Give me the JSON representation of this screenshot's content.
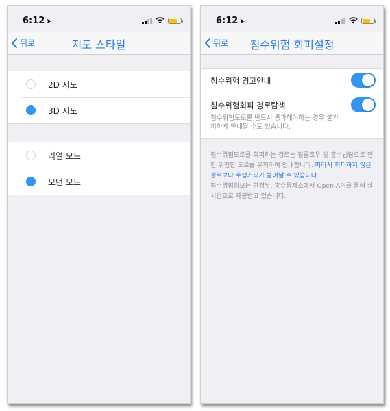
{
  "left": {
    "status": {
      "time": "6:12"
    },
    "nav": {
      "back_label": "뒤로",
      "title": "지도 스타일"
    },
    "groups": [
      {
        "items": [
          {
            "label": "2D 지도",
            "selected": false
          },
          {
            "label": "3D 지도",
            "selected": true
          }
        ]
      },
      {
        "items": [
          {
            "label": "리얼 모드",
            "selected": false
          },
          {
            "label": "모던 모드",
            "selected": true
          }
        ]
      }
    ]
  },
  "right": {
    "status": {
      "time": "6:12"
    },
    "nav": {
      "back_label": "뒤로",
      "title": "침수위험 회피설정"
    },
    "settings": [
      {
        "title": "침수위험 경고안내",
        "on": true
      },
      {
        "title": "침수위험회피 경로탐색",
        "description": "침수위험도로를 반드시 통과해야하는 경우 불가피하게 안내될 수도 있습니다.",
        "on": true
      }
    ],
    "footer": {
      "part1": "침수위험도로를 회피하는 경로는 집중호우 및 홍수범람으로 인한 위험한 도로를 우회하여 안내합니다.",
      "highlight": "따라서 회피하지 않은 경로보다 주행거리가 늘어날 수 있습니다.",
      "part2": "침수위험정보는 환경부, 홍수통제소에서 Open-API를 통해 실시간으로 제공받고 있습니다."
    }
  },
  "colors": {
    "accent": "#2f7de1",
    "radio_on": "#3494f0",
    "toggle_on": "#3494f0",
    "battery": "#f7c600",
    "background": "#efeff4"
  },
  "icons": {
    "location": "location-arrow-icon",
    "signal": "cellular-signal-icon",
    "wifi": "wifi-icon",
    "battery": "battery-icon",
    "back": "chevron-left-icon"
  }
}
